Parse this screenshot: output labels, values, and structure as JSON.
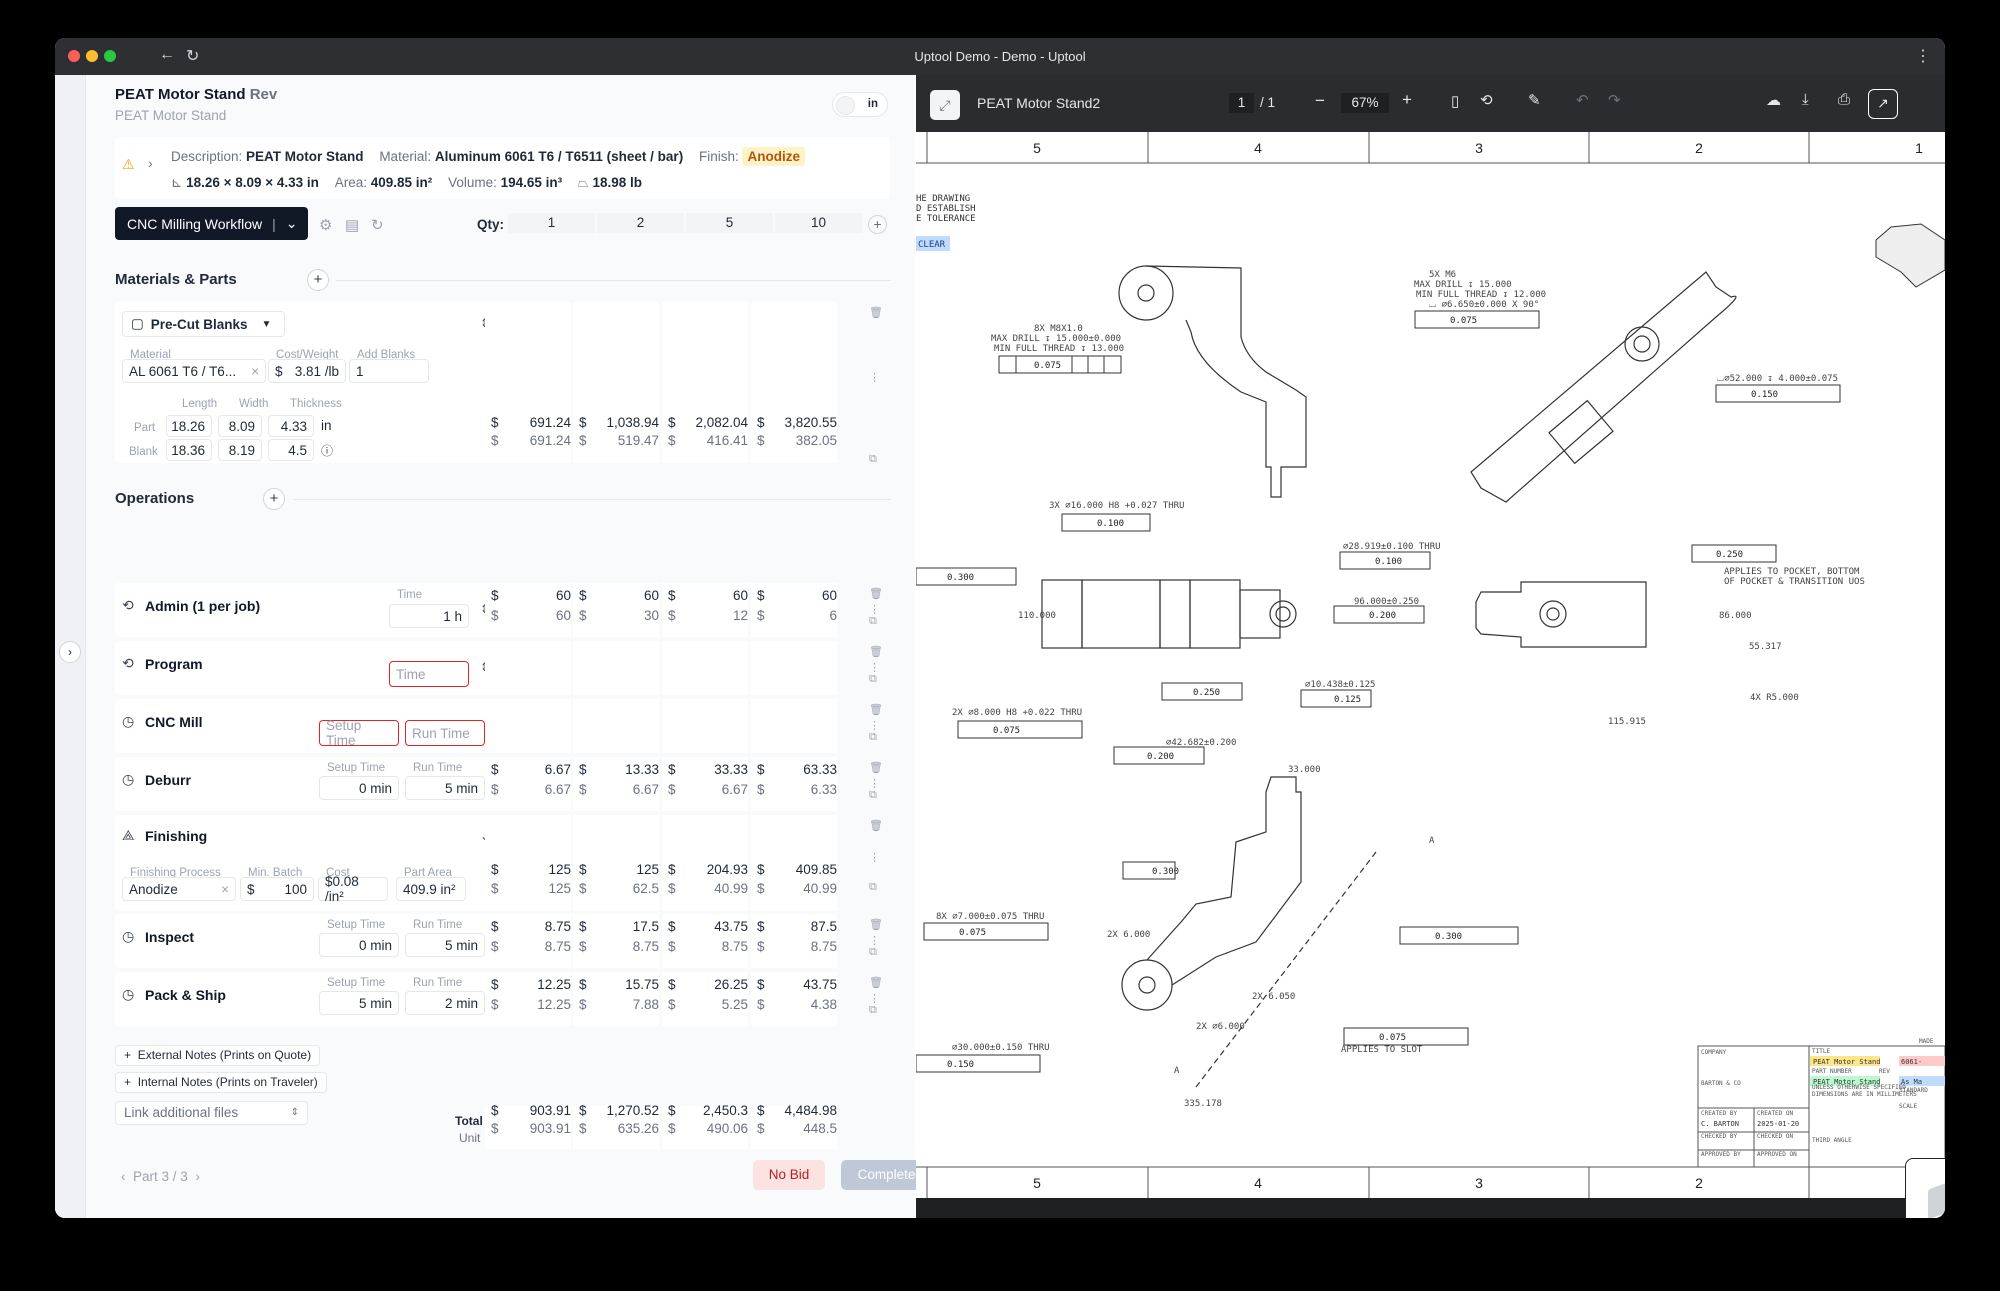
{
  "window": {
    "title": "Uptool Demo - Demo - Uptool"
  },
  "part": {
    "name": "PEAT Motor Stand",
    "rev": "Rev",
    "subtitle": "PEAT Motor Stand",
    "unit_toggle": "in"
  },
  "summary": {
    "description_label": "Description:",
    "description": "PEAT Motor Stand",
    "material_label": "Material:",
    "material": "Aluminum 6061 T6 / T6511 (sheet / bar)",
    "finish_label": "Finish:",
    "finish": "Anodize",
    "dims": "18.26 × 8.09 × 4.33 in",
    "area_label": "Area:",
    "area": "409.85 in²",
    "volume_label": "Volume:",
    "volume": "194.65 in³",
    "weight": "18.98 lb"
  },
  "workflow": {
    "label": "CNC Milling Workflow",
    "qty_label": "Qty:",
    "qtys": [
      "1",
      "2",
      "5",
      "10"
    ]
  },
  "materials": {
    "title": "Materials & Parts",
    "blank_type": "Pre-Cut Blanks",
    "material_label": "Material",
    "material": "AL 6061 T6 / T6...",
    "cost_label": "Cost/Weight",
    "cost_prefix": "$",
    "cost": "3.81 /lb",
    "add_label": "Add Blanks",
    "add": "1",
    "length_label": "Length",
    "width_label": "Width",
    "thickness_label": "Thickness",
    "part_label": "Part",
    "blank_label": "Blank",
    "part_len": "18.26",
    "part_wid": "8.09",
    "part_thk": "4.33",
    "unit": "in",
    "blank_len": "18.36",
    "blank_wid": "8.19",
    "blank_thk": "4.5",
    "totals": [
      "691.24",
      "1,038.94",
      "2,082.04",
      "3,820.55"
    ],
    "units": [
      "691.24",
      "519.47",
      "416.41",
      "382.05"
    ]
  },
  "operations": {
    "title": "Operations",
    "admin": {
      "name": "Admin (1 per job)",
      "time_label": "Time",
      "time": "1 h",
      "totals": [
        "60",
        "60",
        "60",
        "60"
      ],
      "units": [
        "60",
        "30",
        "12",
        "6"
      ]
    },
    "program": {
      "name": "Program",
      "time_placeholder": "Time"
    },
    "cnc": {
      "name": "CNC Mill",
      "setup_placeholder": "Setup Time",
      "run_placeholder": "Run Time"
    },
    "deburr": {
      "name": "Deburr",
      "setup_label": "Setup Time",
      "setup": "0 min",
      "run_label": "Run Time",
      "run": "5 min",
      "totals": [
        "6.67",
        "13.33",
        "33.33",
        "63.33"
      ],
      "units": [
        "6.67",
        "6.67",
        "6.67",
        "6.33"
      ]
    },
    "finishing": {
      "name": "Finishing",
      "process_label": "Finishing Process",
      "process": "Anodize",
      "batch_label": "Min. Batch",
      "batch_prefix": "$",
      "batch": "100",
      "cost_label": "Cost",
      "cost": "$0.08 /in²",
      "area_label": "Part Area",
      "area": "409.9 in²",
      "totals": [
        "125",
        "125",
        "204.93",
        "409.85"
      ],
      "units": [
        "125",
        "62.5",
        "40.99",
        "40.99"
      ]
    },
    "inspect": {
      "name": "Inspect",
      "setup_label": "Setup Time",
      "setup": "0 min",
      "run_label": "Run Time",
      "run": "5 min",
      "totals": [
        "8.75",
        "17.5",
        "43.75",
        "87.5"
      ],
      "units": [
        "8.75",
        "8.75",
        "8.75",
        "8.75"
      ]
    },
    "pack": {
      "name": "Pack & Ship",
      "setup_label": "Setup Time",
      "setup": "5 min",
      "run_label": "Run Time",
      "run": "2 min",
      "totals": [
        "12.25",
        "15.75",
        "26.25",
        "43.75"
      ],
      "units": [
        "12.25",
        "7.88",
        "5.25",
        "4.38"
      ]
    }
  },
  "notes": {
    "external": "External Notes (Prints on Quote)",
    "internal": "Internal Notes (Prints on Traveler)",
    "link_files": "Link additional files"
  },
  "grand": {
    "total_label": "Total",
    "unit_label": "Unit",
    "totals": [
      "903.91",
      "1,270.52",
      "2,450.3",
      "4,484.98"
    ],
    "units": [
      "903.91",
      "635.26",
      "490.06",
      "448.5"
    ]
  },
  "footer": {
    "part_nav": "Part 3 / 3",
    "no_bid": "No Bid",
    "complete": "Complete"
  },
  "pdf": {
    "title": "PEAT Motor Stand2",
    "page": "1",
    "pages": "/ 1",
    "zoom": "67%"
  },
  "drawing": {
    "zones_top": [
      "5",
      "4",
      "3",
      "2",
      "1"
    ],
    "zones_bottom": [
      "5",
      "4",
      "3",
      "2"
    ],
    "note1": "HE DRAWING",
    "note2": "D ESTABLISH",
    "note3": "E TOLERANCE",
    "clear": "CLEAR",
    "c1": "8X M8X1.0",
    "c2": "MAX DRILL ↧ 15.000±0.000",
    "c3": "MIN FULL THREAD ↧ 13.000",
    "c4": "5X M6",
    "c5": "MAX DRILL ↧ 15.000",
    "c6": "MIN FULL THREAD ↧ 12.000",
    "c7": "⌴ ∅6.650±0.000 X 90°",
    "c8": "⌴∅52.000 ↧ 4.000±0.075",
    "c9": "3X ∅16.000 H8 +0.027 THRU",
    "c10": "∅28.919±0.100 THRU",
    "c11": "96.000±0.250",
    "c12": "APPLIES TO POCKET, BOTTOM",
    "c13": "OF POCKET & TRANSITION UOS",
    "c14": "86.000",
    "c15": "55.317",
    "c16": "4X R5.000",
    "c17": "115.915",
    "c18": "110.000",
    "c19": "∅10.438±0.125",
    "c20": "2X ∅8.000 H8 +0.022 THRU",
    "c21": "∅42.682±0.200",
    "c22": "33.000",
    "c23": "8X ∅7.000±0.075 THRU",
    "c24": "2X 6.000",
    "c25": "2X 6.050",
    "c26": "2X ∅6.000",
    "c27": "∅30.000±0.150 THRU",
    "c28": "APPLIES TO SLOT",
    "c29": "335.178",
    "c30": "A",
    "c31": "A",
    "f1": "0.075",
    "f2": "0.150",
    "f3": "0.100",
    "f4": "0.300",
    "f5": "0.250",
    "f6": "0.200",
    "f7": "0.125",
    "f8": "0.300",
    "f9": "0.075",
    "f10": "0.300",
    "f11": "0.150",
    "f12": "0.250",
    "f13": "0.075",
    "f14": "0.200",
    "tb_company_label": "COMPANY",
    "tb_company": "BARTON & CO",
    "tb_title_label": "TITLE",
    "tb_title": "PEAT Motor Stand",
    "tb_pn_label": "PART NUMBER",
    "tb_pn": "PEAT Motor Stand",
    "tb_rev": "REV",
    "tb_created_by": "CREATED BY",
    "tb_author": "C. BARTON",
    "tb_created_on": "CREATED ON",
    "tb_date": "2025-01-20",
    "tb_checked_by": "CHECKED BY",
    "tb_checked_on": "CHECKED ON",
    "tb_approved_by": "APPROVED BY",
    "tb_approved_on": "APPROVED ON",
    "tb_unless": "UNLESS OTHERWISE SPECIFIED",
    "tb_dims": "DIMENSIONS ARE IN MILLIMETERS",
    "tb_scale": "SCALE",
    "tb_standard": "STANDARD",
    "tb_made": "MADE",
    "tb_6061": "6061-",
    "tb_asma": "As Ma",
    "tb_third": "THIRD ANGLE"
  },
  "colors": {
    "accent": "#111827",
    "danger": "#dc2626",
    "finish_badge": "#fef3c7",
    "no_bid_bg": "#fde2e2",
    "complete_bg": "#bfc8d6",
    "pdf_bg": "#1f2023"
  }
}
